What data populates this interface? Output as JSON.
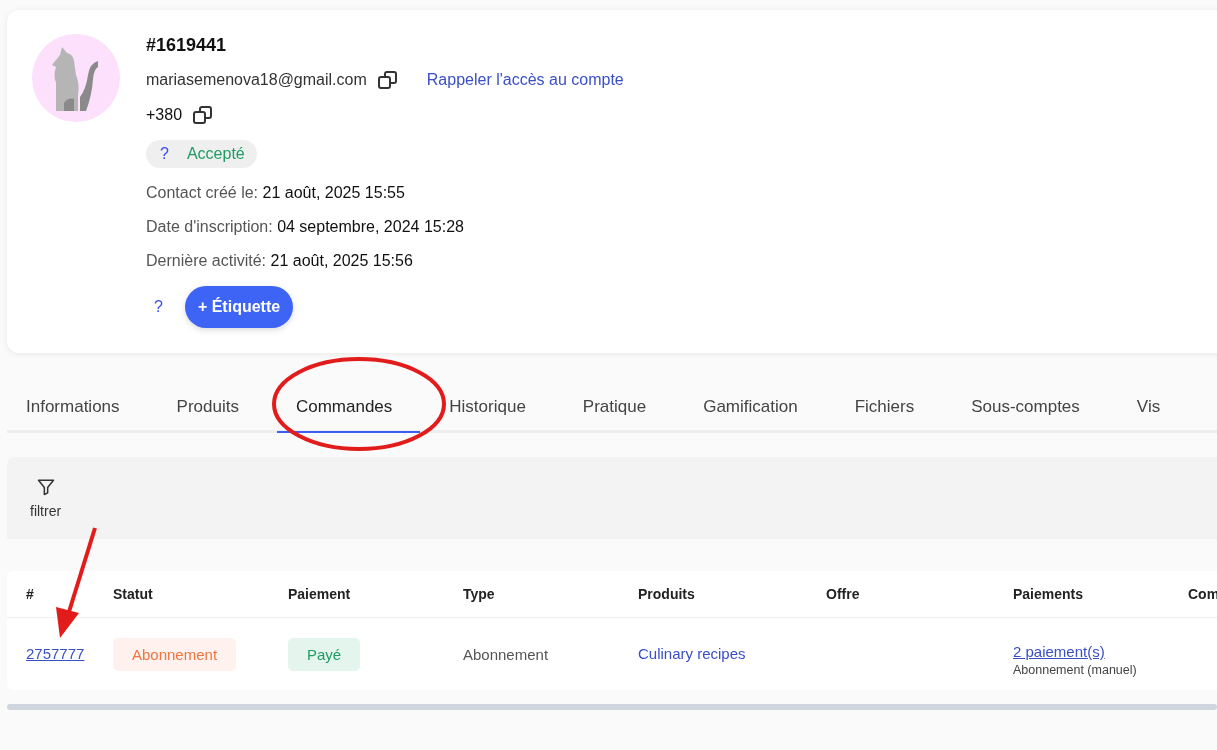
{
  "contact": {
    "id": "#1619441",
    "email": "mariasemenova18@gmail.com",
    "reset_link": "Rappeler l'accès au compte",
    "phone": "+380",
    "status": {
      "help": "?",
      "label": "Accepté"
    },
    "details": [
      {
        "label": "Contact créé le:",
        "value": "21 août, 2025 15:55"
      },
      {
        "label": "Date d'inscription:",
        "value": "04 septembre, 2024 15:28"
      },
      {
        "label": "Dernière activité:",
        "value": "21 août, 2025 15:56"
      }
    ],
    "tag_help": "?",
    "tag_button": "+ Étiquette"
  },
  "tabs": [
    {
      "label": "Informations",
      "selected": false
    },
    {
      "label": "Produits",
      "selected": false
    },
    {
      "label": "Commandes",
      "selected": true
    },
    {
      "label": "Historique",
      "selected": false
    },
    {
      "label": "Pratique",
      "selected": false
    },
    {
      "label": "Gamification",
      "selected": false
    },
    {
      "label": "Fichiers",
      "selected": false
    },
    {
      "label": "Sous-comptes",
      "selected": false
    },
    {
      "label": "Vis",
      "selected": false
    }
  ],
  "filter": {
    "label": "filtrer"
  },
  "table": {
    "columns": [
      "#",
      "Statut",
      "Paiement",
      "Type",
      "Produits",
      "Offre",
      "Paiements",
      "Com"
    ],
    "rows": [
      {
        "number": "2757777",
        "status": "Abonnement",
        "payment": "Payé",
        "type": "Abonnement",
        "product": "Culinary recipes",
        "payments_link": "2 paiement(s)",
        "payments_note": "Abonnement (manuel)"
      }
    ]
  }
}
